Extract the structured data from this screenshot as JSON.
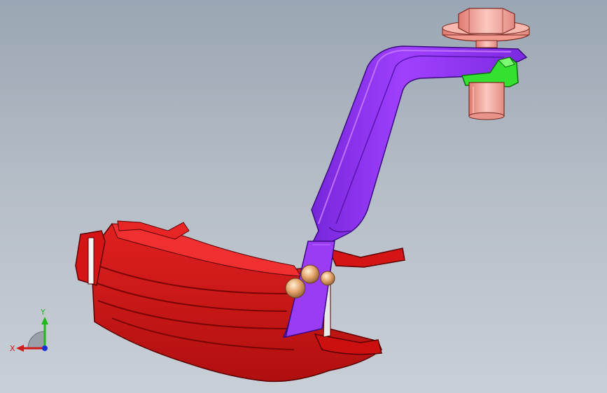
{
  "triad": {
    "x_label": "X",
    "y_label": "Y",
    "colors": {
      "x": "#d11a1a",
      "y": "#1fb81f",
      "z": "#1b2fd6"
    }
  },
  "parts": [
    {
      "name": "clamp-body",
      "color": "#d11a1a"
    },
    {
      "name": "bracket-arm",
      "color": "#8a2be2"
    },
    {
      "name": "bolt-head",
      "color": "#f29a90"
    },
    {
      "name": "spacer-sleeve",
      "color": "#34e030"
    },
    {
      "name": "rivets",
      "color": "#e8a070"
    }
  ]
}
